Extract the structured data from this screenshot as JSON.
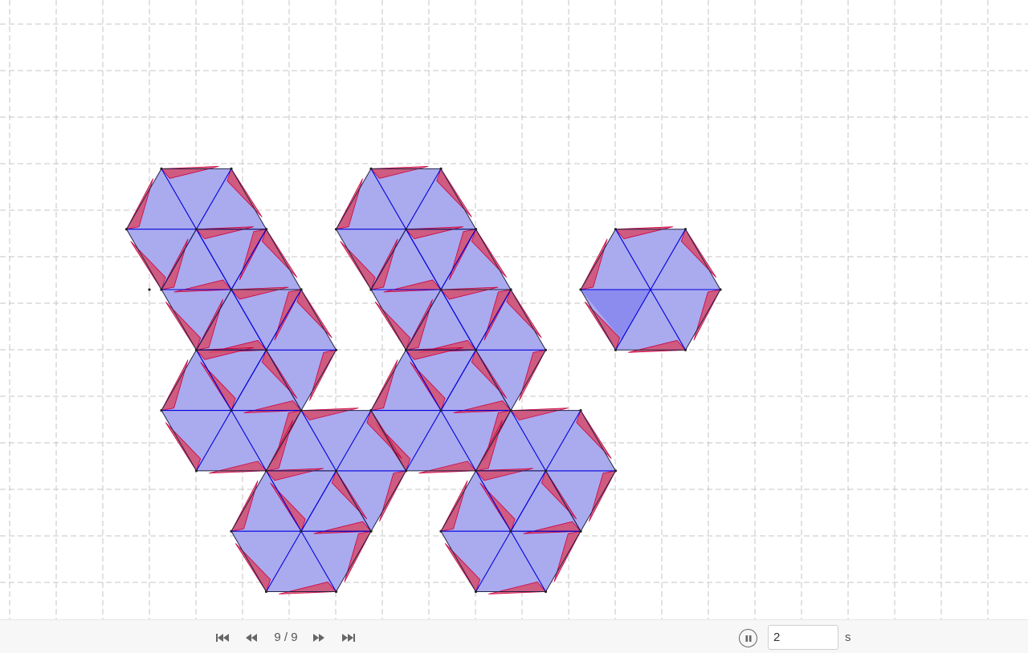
{
  "playback": {
    "step_text": "9 / 9",
    "interval_value": "2",
    "interval_unit": "s"
  },
  "icons": {
    "first": "skip-to-start-icon",
    "previous": "step-back-icon",
    "next": "step-forward-icon",
    "last": "skip-to-end-icon",
    "pause": "pause-icon"
  },
  "colors": {
    "grid": "#c4c4c4",
    "triangle_fill": "#aaaaee",
    "triangle_edge": "#0000dd",
    "kite_fill": "#d64d6c",
    "kite_edge": "#cc0044",
    "highlight_fill": "#8888ee",
    "toolbar_bg": "#f7f7f7"
  }
}
